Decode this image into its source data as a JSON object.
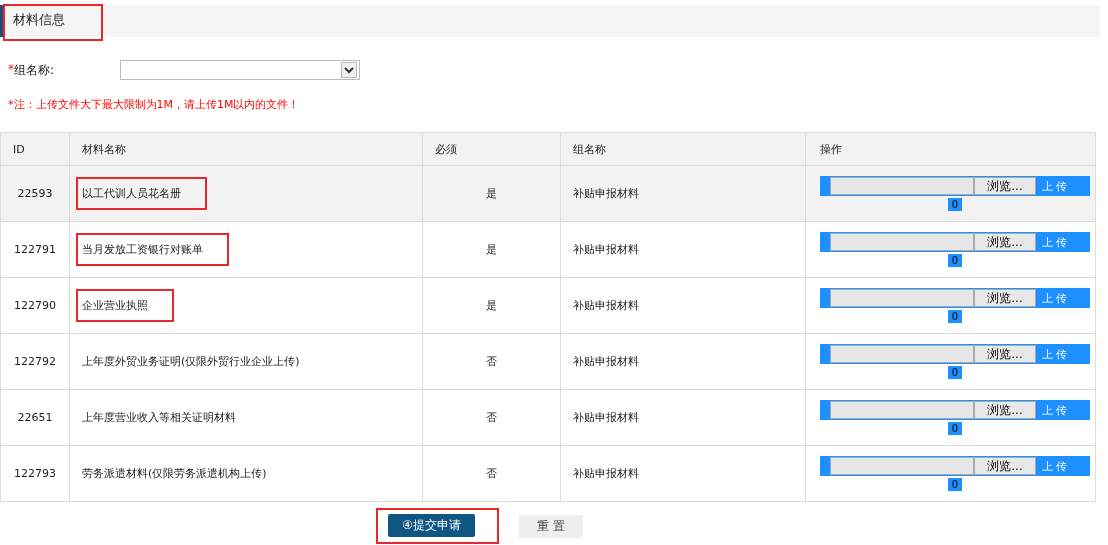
{
  "section": {
    "title": "材料信息",
    "highlighted": true
  },
  "group_field": {
    "required_mark": "*",
    "label": "组名称:"
  },
  "notice": "*注：上传文件大下最大限制为1M，请上传1M以内的文件！",
  "table": {
    "columns": [
      "ID",
      "材料名称",
      "必须",
      "组名称",
      "操作"
    ],
    "rows": [
      {
        "id": "22593",
        "name": "以工代训人员花名册",
        "required": "是",
        "group": "补贴申报材料",
        "browse": "浏览...",
        "upload": "上 传",
        "count": "0",
        "selected": true,
        "highlighted": true
      },
      {
        "id": "122791",
        "name": "当月发放工资银行对账单",
        "required": "是",
        "group": "补贴申报材料",
        "browse": "浏览...",
        "upload": "上 传",
        "count": "0",
        "selected": false,
        "highlighted": true
      },
      {
        "id": "122790",
        "name": "企业营业执照",
        "required": "是",
        "group": "补贴申报材料",
        "browse": "浏览...",
        "upload": "上 传",
        "count": "0",
        "selected": false,
        "highlighted": true
      },
      {
        "id": "122792",
        "name": "上年度外贸业务证明(仅限外贸行业企业上传)",
        "required": "否",
        "group": "补贴申报材料",
        "browse": "浏览...",
        "upload": "上 传",
        "count": "0",
        "selected": false,
        "highlighted": false
      },
      {
        "id": "22651",
        "name": "上年度营业收入等相关证明材料",
        "required": "否",
        "group": "补贴申报材料",
        "browse": "浏览...",
        "upload": "上 传",
        "count": "0",
        "selected": false,
        "highlighted": false
      },
      {
        "id": "122793",
        "name": "劳务派遣材料(仅限劳务派遣机构上传)",
        "required": "否",
        "group": "补贴申报材料",
        "browse": "浏览...",
        "upload": "上 传",
        "count": "0",
        "selected": false,
        "highlighted": false
      }
    ]
  },
  "buttons": {
    "submit": {
      "label": "④提交申请",
      "highlighted": true
    },
    "reset": {
      "label": "重 置"
    }
  }
}
